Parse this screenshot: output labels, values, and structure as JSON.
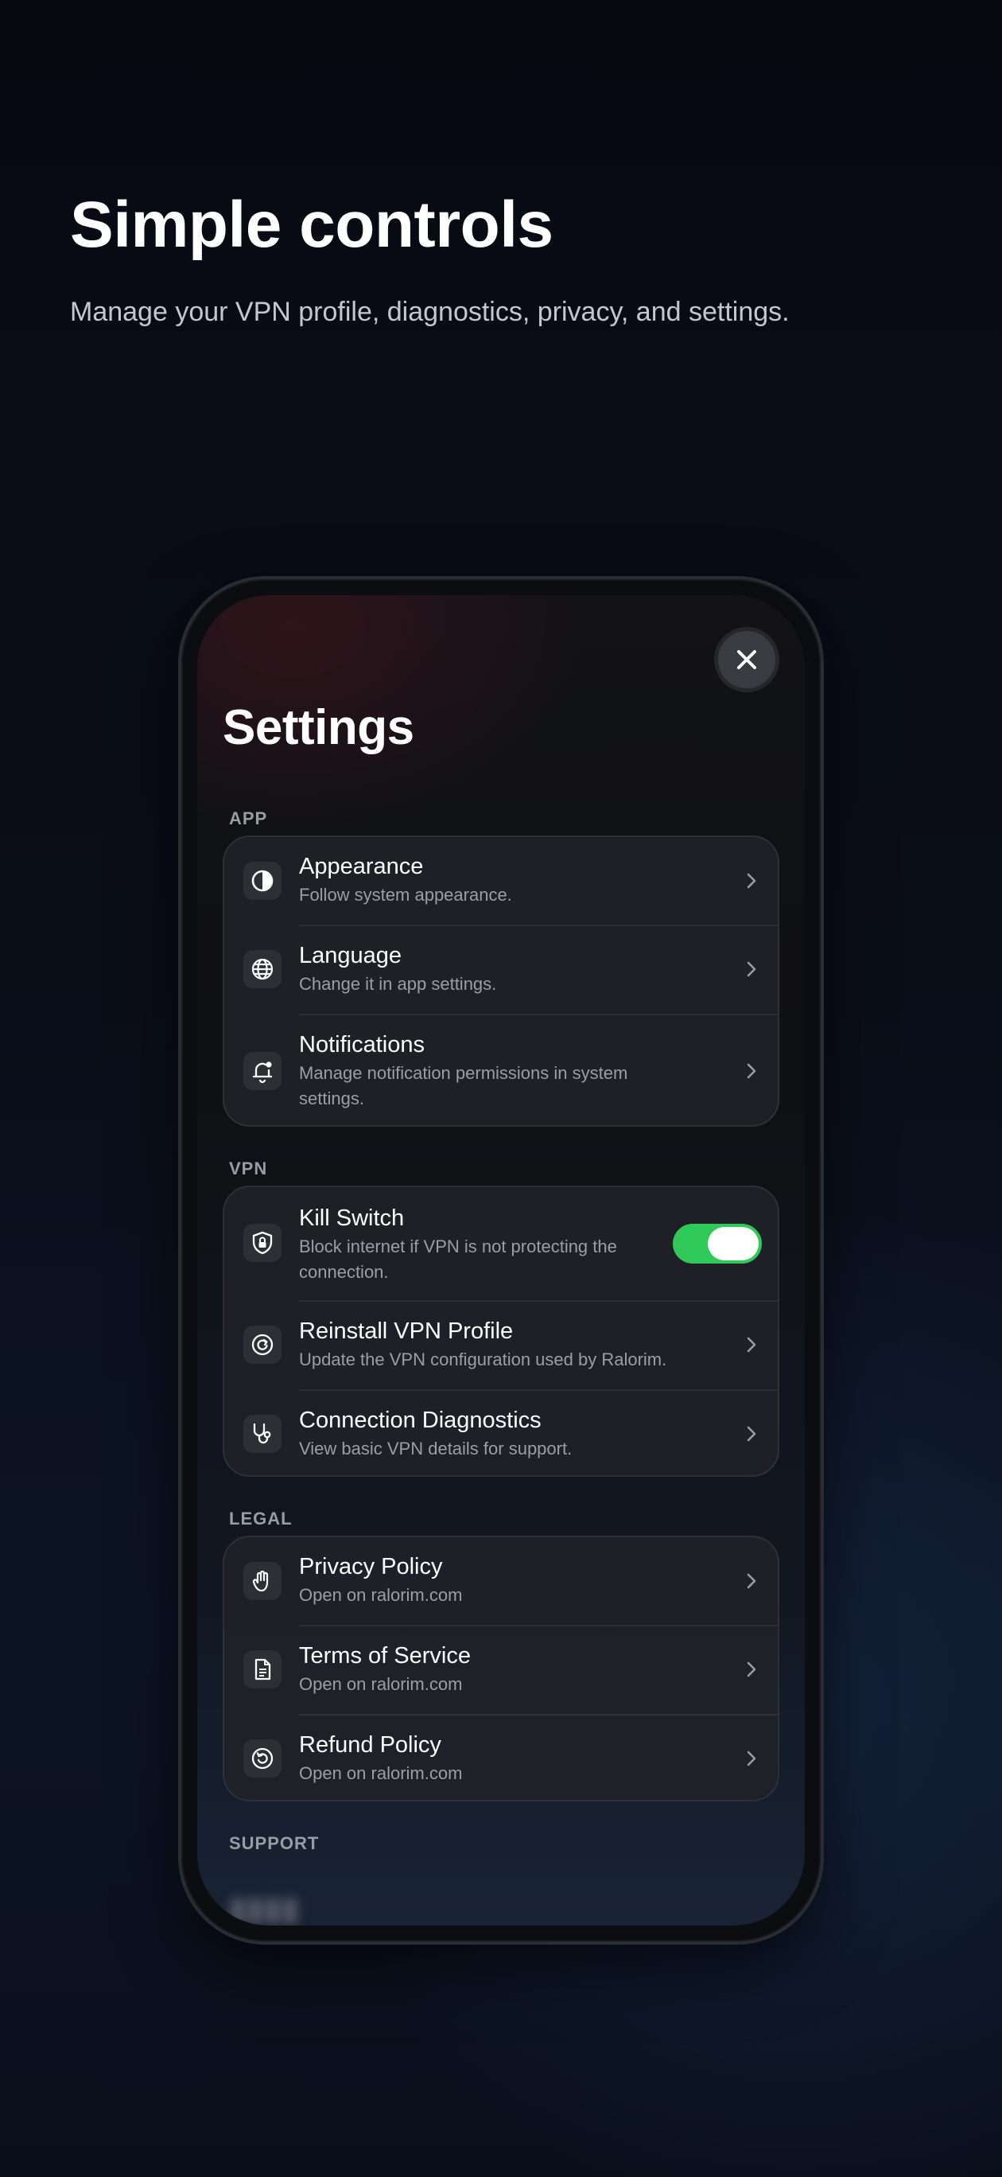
{
  "hero": {
    "title": "Simple controls",
    "subtitle": "Manage your VPN profile, diagnostics, privacy, and settings."
  },
  "settings": {
    "title": "Settings",
    "sections": {
      "app": {
        "label": "APP",
        "items": [
          {
            "icon": "contrast-icon",
            "title": "Appearance",
            "subtitle": "Follow system appearance."
          },
          {
            "icon": "globe-icon",
            "title": "Language",
            "subtitle": "Change it in app settings."
          },
          {
            "icon": "bell-icon",
            "title": "Notifications",
            "subtitle": "Manage notification permissions in system settings."
          }
        ]
      },
      "vpn": {
        "label": "VPN",
        "items": [
          {
            "icon": "shield-lock-icon",
            "title": "Kill Switch",
            "subtitle": "Block internet if VPN is not protecting the connection.",
            "toggle_on": true
          },
          {
            "icon": "refresh-icon",
            "title": "Reinstall VPN Profile",
            "subtitle": "Update the VPN configuration used by Ralorim."
          },
          {
            "icon": "stethoscope-icon",
            "title": "Connection Diagnostics",
            "subtitle": "View basic VPN details for support."
          }
        ]
      },
      "legal": {
        "label": "LEGAL",
        "items": [
          {
            "icon": "hand-icon",
            "title": "Privacy Policy",
            "subtitle": "Open on ralorim.com"
          },
          {
            "icon": "document-icon",
            "title": "Terms of Service",
            "subtitle": "Open on ralorim.com"
          },
          {
            "icon": "refund-icon",
            "title": "Refund Policy",
            "subtitle": "Open on ralorim.com"
          }
        ]
      },
      "support": {
        "label": "SUPPORT"
      }
    }
  },
  "colors": {
    "toggle_on": "#2fc95a",
    "background": "#0a0e19"
  }
}
